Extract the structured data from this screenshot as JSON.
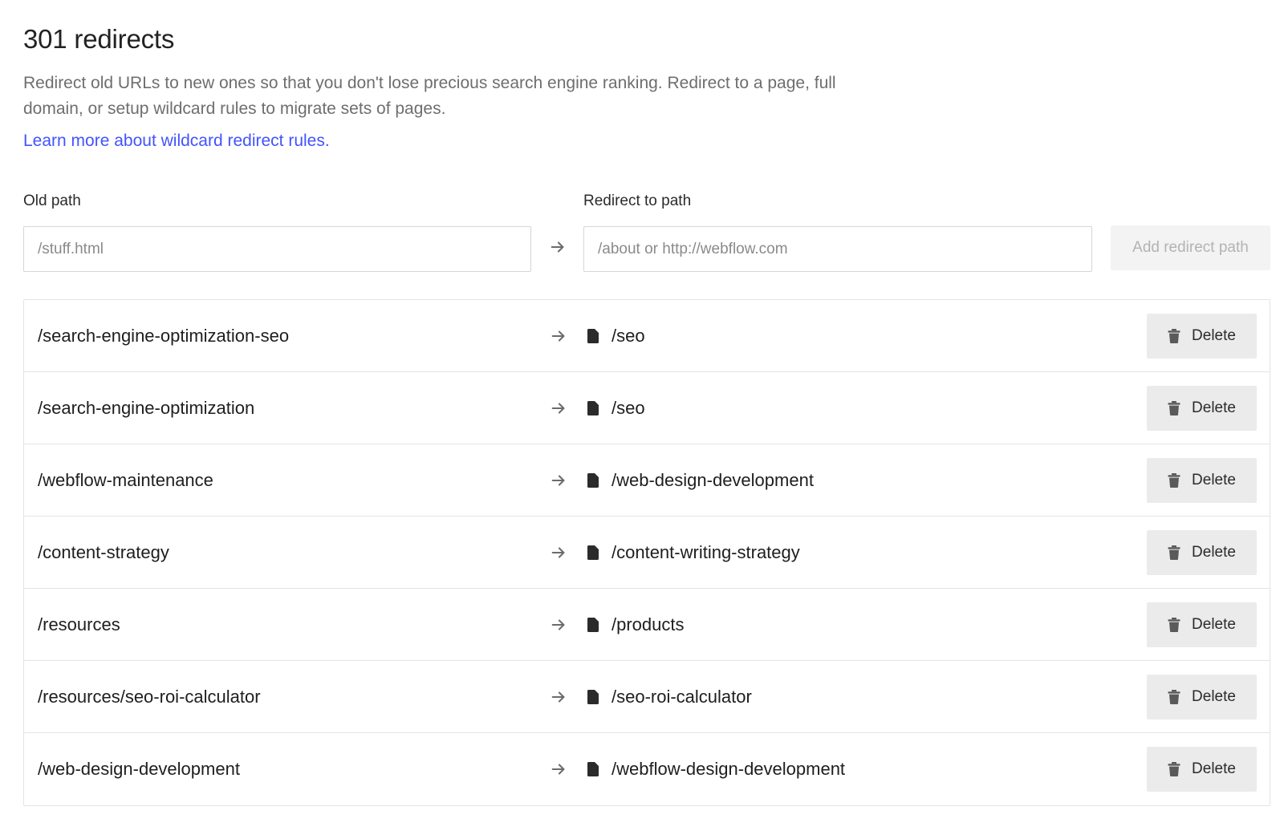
{
  "header": {
    "title": "301 redirects",
    "description": "Redirect old URLs to new ones so that you don't lose precious search engine ranking. Redirect to a page, full domain, or setup wildcard rules to migrate sets of pages.",
    "learn_link": "Learn more about wildcard redirect rules."
  },
  "form": {
    "old_label": "Old path",
    "old_placeholder": "/stuff.html",
    "new_label": "Redirect to path",
    "new_placeholder": "/about or http://webflow.com",
    "add_button": "Add redirect path",
    "arrow_icon": "arrow-right-icon"
  },
  "redirects": [
    {
      "old": "/search-engine-optimization-seo",
      "new": "/seo"
    },
    {
      "old": "/search-engine-optimization",
      "new": "/seo"
    },
    {
      "old": "/webflow-maintenance",
      "new": "/web-design-development"
    },
    {
      "old": "/content-strategy",
      "new": "/content-writing-strategy"
    },
    {
      "old": "/resources",
      "new": "/products"
    },
    {
      "old": "/resources/seo-roi-calculator",
      "new": "/seo-roi-calculator"
    },
    {
      "old": "/web-design-development",
      "new": "/webflow-design-development"
    }
  ],
  "row_labels": {
    "delete_button": "Delete",
    "page_icon": "page-icon",
    "trash_icon": "trash-icon"
  },
  "colors": {
    "link": "#4353ff",
    "delete_bg": "#ebebeb",
    "add_button_bg": "#f3f3f3",
    "border": "#e4e4e4"
  }
}
